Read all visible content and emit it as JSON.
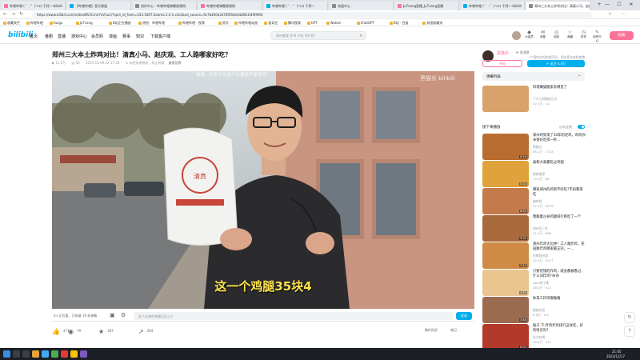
{
  "browser": {
    "tabs": [
      "哔哩哔哩 ( ゜- ゜)つロ 干杯~-bilibili",
      "【哔哩哔哩】音乐频道",
      "创作中心 - 哔哩哔哩弹幕视频网",
      "哔哩哔哩弹幕视频网",
      "哔哩哔哩 ( ゜- ゜)つロ 干杯~",
      "充值中心",
      "JuTvang直播_JuTvang直播",
      "哔哩哔哩 ( ゜- ゜)つロ 干杯~-bilibili",
      "郑州三大本土炸鸡对比！清真小马、赵庆..."
    ],
    "window_controls": [
      "—",
      "☐",
      "✕"
    ],
    "url": "https://www.bilibili.com/video/BV1Cmh7eV1uC/?spm_id_from=333.1007.tianma.1-2-2.click&vd_source=9c7b460d2d78f5fd4e5b6fb1f4f699fd",
    "bookmarks": [
      "收藏夹栏",
      "哔哩哔哩",
      "Guigu",
      "JuTvang",
      "B站正在播放",
      "原创 · 哔哩哔哩",
      "哔哩哔哩 · 视频",
      "资讯",
      "哔哩哔哩动画",
      "爱奇艺",
      "腾讯视频",
      "GPT",
      "Notion",
      "ChatGPT",
      "B站 · 百度",
      "其他收藏夹"
    ]
  },
  "site_header": {
    "logo": "bilibili",
    "nav": [
      "首页",
      "番剧",
      "直播",
      "游戏中心",
      "会员购",
      "漫画",
      "赛事",
      "知识",
      "下载客户端"
    ],
    "search_placeholder": "郑州美食 炸鸡 小吃 排行榜",
    "icons": [
      {
        "name": "big-member-icon",
        "label": "大会员",
        "glyph": "◆"
      },
      {
        "name": "message-icon",
        "label": "消息",
        "glyph": "✉"
      },
      {
        "name": "dynamic-icon",
        "label": "动态",
        "glyph": "◎"
      },
      {
        "name": "favorite-icon",
        "label": "收藏",
        "glyph": "☆"
      },
      {
        "name": "history-icon",
        "label": "历史",
        "glyph": "◷"
      },
      {
        "name": "creation-icon",
        "label": "创作中心",
        "glyph": "✎"
      }
    ],
    "upload_label": "投稿"
  },
  "video": {
    "title": "郑州三大本土炸鸡对比！清真小马、赵庆观、工人路哪家好吃？",
    "views": "13.2万",
    "danmaku_count": "56",
    "date": "2024-10-09 22:17:26",
    "category": "美食侦探",
    "original_note": "未经作者授权，禁止转载",
    "subtitle": "这一个鸡腿35块4",
    "overlay_text": "看看，外卖平台这个价格是不是更贵？",
    "watermark": "黑猫长 bilibili",
    "watching": "6人正在看，已装填 16 条弹幕",
    "danmaku_placeholder": "发个友善的弹幕见证当下",
    "send_label": "发送",
    "stats": [
      {
        "name": "like-icon",
        "glyph": "👍",
        "value": "477"
      },
      {
        "name": "coin-icon",
        "glyph": "◉",
        "value": "79"
      },
      {
        "name": "fav-star-icon",
        "glyph": "★",
        "value": "387"
      },
      {
        "name": "share-icon",
        "glyph": "↗",
        "value": "264"
      }
    ],
    "right_tools": [
      "稿件投诉",
      "笔记"
    ]
  },
  "uploader": {
    "name": "黑猫长",
    "badge": "发消息",
    "desc": "一个爱吃炸鸡的程序员，探店郑州各种美食",
    "charge_label": "充电",
    "follow_label": "+ 关注 4.4万",
    "danmaku_list_label": "弹幕列表",
    "autoplay_label": "接下来播放",
    "autoplay_toggle": "自动连播"
  },
  "recommendations": [
    {
      "title": "料理嫩猫搬家去哪里了",
      "up": "下方小说播放正式",
      "stats": "10.7万 · 12",
      "dur": "",
      "color": "#d7a36b"
    },
    {
      "title": "郑州鸡架来了30年的老鸡，鸡肉你米香好吃得一秒...",
      "up": "黑猫长",
      "stats": "58.1万 · 1743",
      "dur": "6:18",
      "color": "#b96c2f"
    },
    {
      "title": "泰和大家都吃过鸡翅",
      "up": "美食推荐",
      "stats": "13.5万 · 88",
      "dur": "5:02",
      "color": "#e0a23a"
    },
    {
      "title": "哪家郑州的鸡架不好吃?不如我来吃",
      "up": "咖啡吧",
      "stats": "37.9万 · 4679",
      "dur": "8:44",
      "color": "#c47a4a"
    },
    {
      "title": "我跟着沙县鸡腿排行榜吃了一个",
      "up": "郑州阿二冬",
      "stats": "31.2万 · 986",
      "dur": "9:31",
      "color": "#a86a3c"
    },
    {
      "title": "郑州炸鸡大比拼！工人路炸鸡、花园路炸鸡哪家最正宗，一...",
      "up": "吃喝郑州姐",
      "stats": "42.0万 · 2017",
      "dur": "7:12",
      "color": "#cf8a45"
    },
    {
      "title": "只要花钱的炸鸡，就会都被看过，什么叫炸鸡?😅😅",
      "up": "Ubin的小食",
      "stats": "26.4万 · 511",
      "dur": "4:55",
      "color": "#e9c690"
    },
    {
      "title": "你来三炸鸡嗷嗷嗷",
      "up": "超级吃货",
      "stats": "9.8万 · 102",
      "dur": "3:40",
      "color": "#9b6b50"
    },
    {
      "title": "瓶子·下·炸鸡炸鸡排行这样吃，好的哈买吗?",
      "up": "东北吃喝",
      "stats": "18.6万 · 347",
      "dur": "6:01",
      "color": "#b33a2a"
    }
  ],
  "taskbar": {
    "time": "21:05",
    "date": "2023/12/17"
  }
}
